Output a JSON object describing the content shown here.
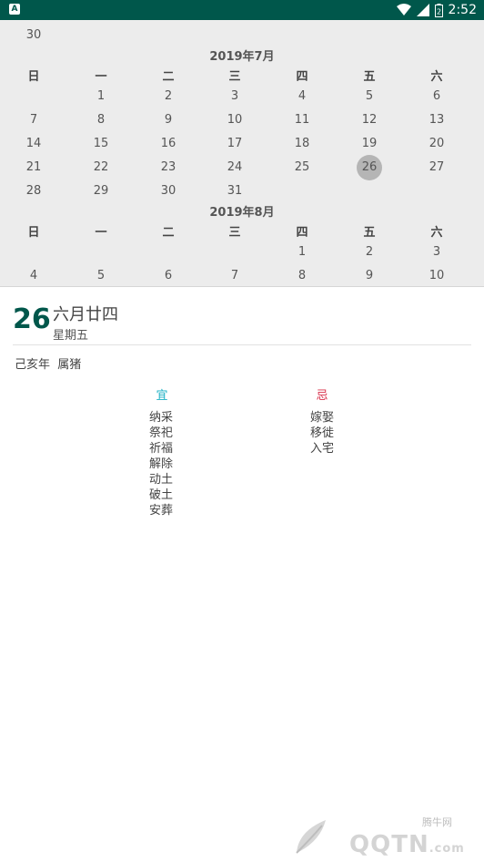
{
  "status_bar": {
    "app_icon": "A",
    "time": "2:52",
    "battery_level": "2"
  },
  "calendar": {
    "prev_month_tail": [
      {
        "day": "30"
      }
    ],
    "july": {
      "title": "2019年7月",
      "weekdays": [
        "日",
        "一",
        "二",
        "三",
        "四",
        "五",
        "六"
      ],
      "weeks": [
        [
          "",
          "1",
          "2",
          "3",
          "4",
          "5",
          "6"
        ],
        [
          "7",
          "8",
          "9",
          "10",
          "11",
          "12",
          "13"
        ],
        [
          "14",
          "15",
          "16",
          "17",
          "18",
          "19",
          "20"
        ],
        [
          "21",
          "22",
          "23",
          "24",
          "25",
          "26",
          "27"
        ],
        [
          "28",
          "29",
          "30",
          "31",
          "",
          "",
          ""
        ]
      ],
      "selected_day": "26"
    },
    "august": {
      "title": "2019年8月",
      "weekdays": [
        "日",
        "一",
        "二",
        "三",
        "四",
        "五",
        "六"
      ],
      "weeks": [
        [
          "",
          "",
          "",
          "",
          "1",
          "2",
          "3"
        ],
        [
          "4",
          "5",
          "6",
          "7",
          "8",
          "9",
          "10"
        ]
      ]
    }
  },
  "detail": {
    "day": "26",
    "lunar_date": "六月廿四",
    "weekday": "星期五",
    "year_info": "己亥年  属猪",
    "yi_title": "宜",
    "ji_title": "忌",
    "yi_items": [
      "纳采",
      "祭祀",
      "祈福",
      "解除",
      "动土",
      "破土",
      "安葬"
    ],
    "ji_items": [
      "嫁娶",
      "移徙",
      "入宅"
    ]
  },
  "watermark": {
    "text": "QQTN",
    "domain": ".com",
    "site_name": "腾牛网"
  },
  "colors": {
    "status_bar": "#00574b",
    "accent": "#00574b",
    "yi": "#1ab0c4",
    "ji": "#d8304a"
  }
}
